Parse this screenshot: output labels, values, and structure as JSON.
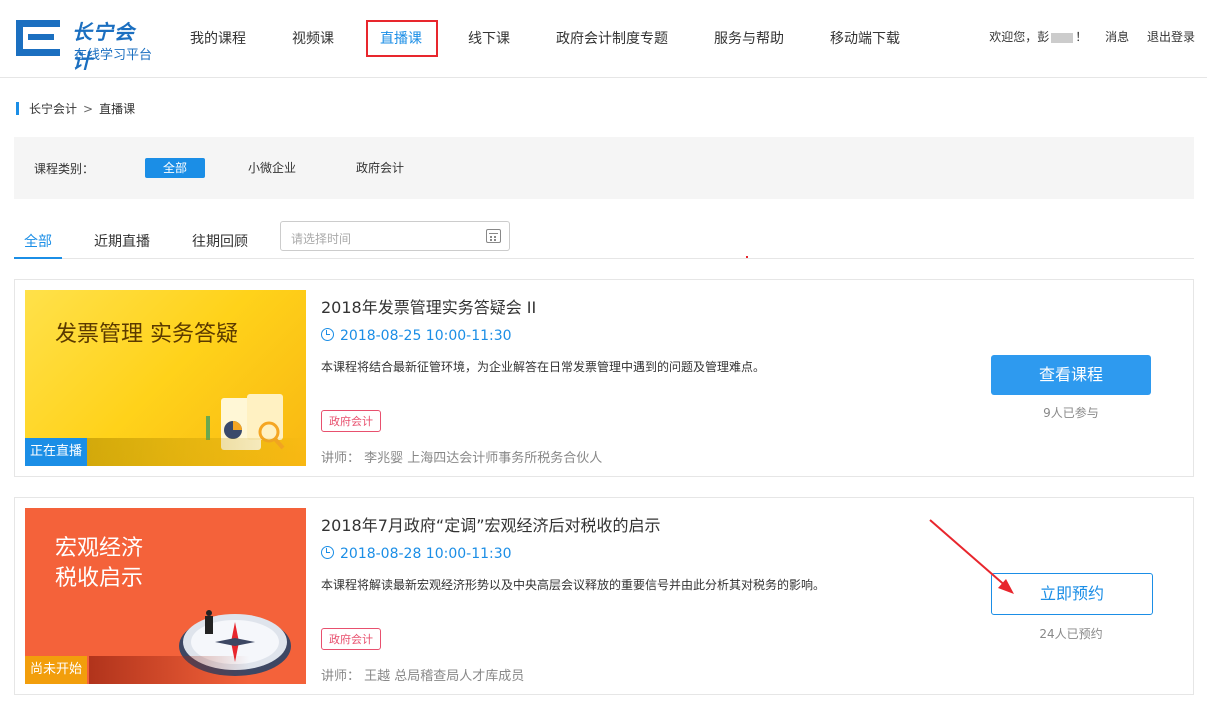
{
  "header": {
    "logo_main": "长宁会计",
    "logo_sub": "在线学习平台",
    "nav": [
      "我的课程",
      "视频课",
      "直播课",
      "线下课",
      "政府会计制度专题",
      "服务与帮助",
      "移动端下载"
    ],
    "active_nav": "直播课",
    "welcome": "欢迎您，彭",
    "welcome_end": "！",
    "messages": "消息",
    "logout": "退出登录"
  },
  "breadcrumb": {
    "home": "长宁会计",
    "sep": ">",
    "current": "直播课"
  },
  "filter": {
    "label": "课程类别：",
    "options": [
      "全部",
      "小微企业",
      "政府会计"
    ],
    "active": "全部"
  },
  "tabs": {
    "items": [
      "全部",
      "近期直播",
      "往期回顾"
    ],
    "active": "全部",
    "date_placeholder": "请选择时间"
  },
  "courses": [
    {
      "thumb_title": "发票管理 实务答疑",
      "status": "正在直播",
      "title": "2018年发票管理实务答疑会 II",
      "time": "2018-08-25 10:00-11:30",
      "desc": "本课程将结合最新征管环境，为企业解答在日常发票管理中遇到的问题及管理难点。",
      "tag": "政府会计",
      "lecturer": "讲师：  李兆婴   上海四达会计师事务所税务合伙人",
      "button": "查看课程",
      "count": "9人已参与"
    },
    {
      "thumb_title_line1": "宏观经济",
      "thumb_title_line2": "税收启示",
      "status": "尚未开始",
      "title": "2018年7月政府“定调”宏观经济后对税收的启示",
      "time": "2018-08-28 10:00-11:30",
      "desc": "本课程将解读最新宏观经济形势以及中央高层会议释放的重要信号并由此分析其对税务的影响。",
      "tag": "政府会计",
      "lecturer": "讲师：  王越   总局稽查局人才库成员",
      "button": "立即预约",
      "count": "24人已预约"
    }
  ],
  "colors": {
    "accent": "#1b8ee6",
    "annotation": "#e8262d",
    "tag": "#e8506e"
  }
}
